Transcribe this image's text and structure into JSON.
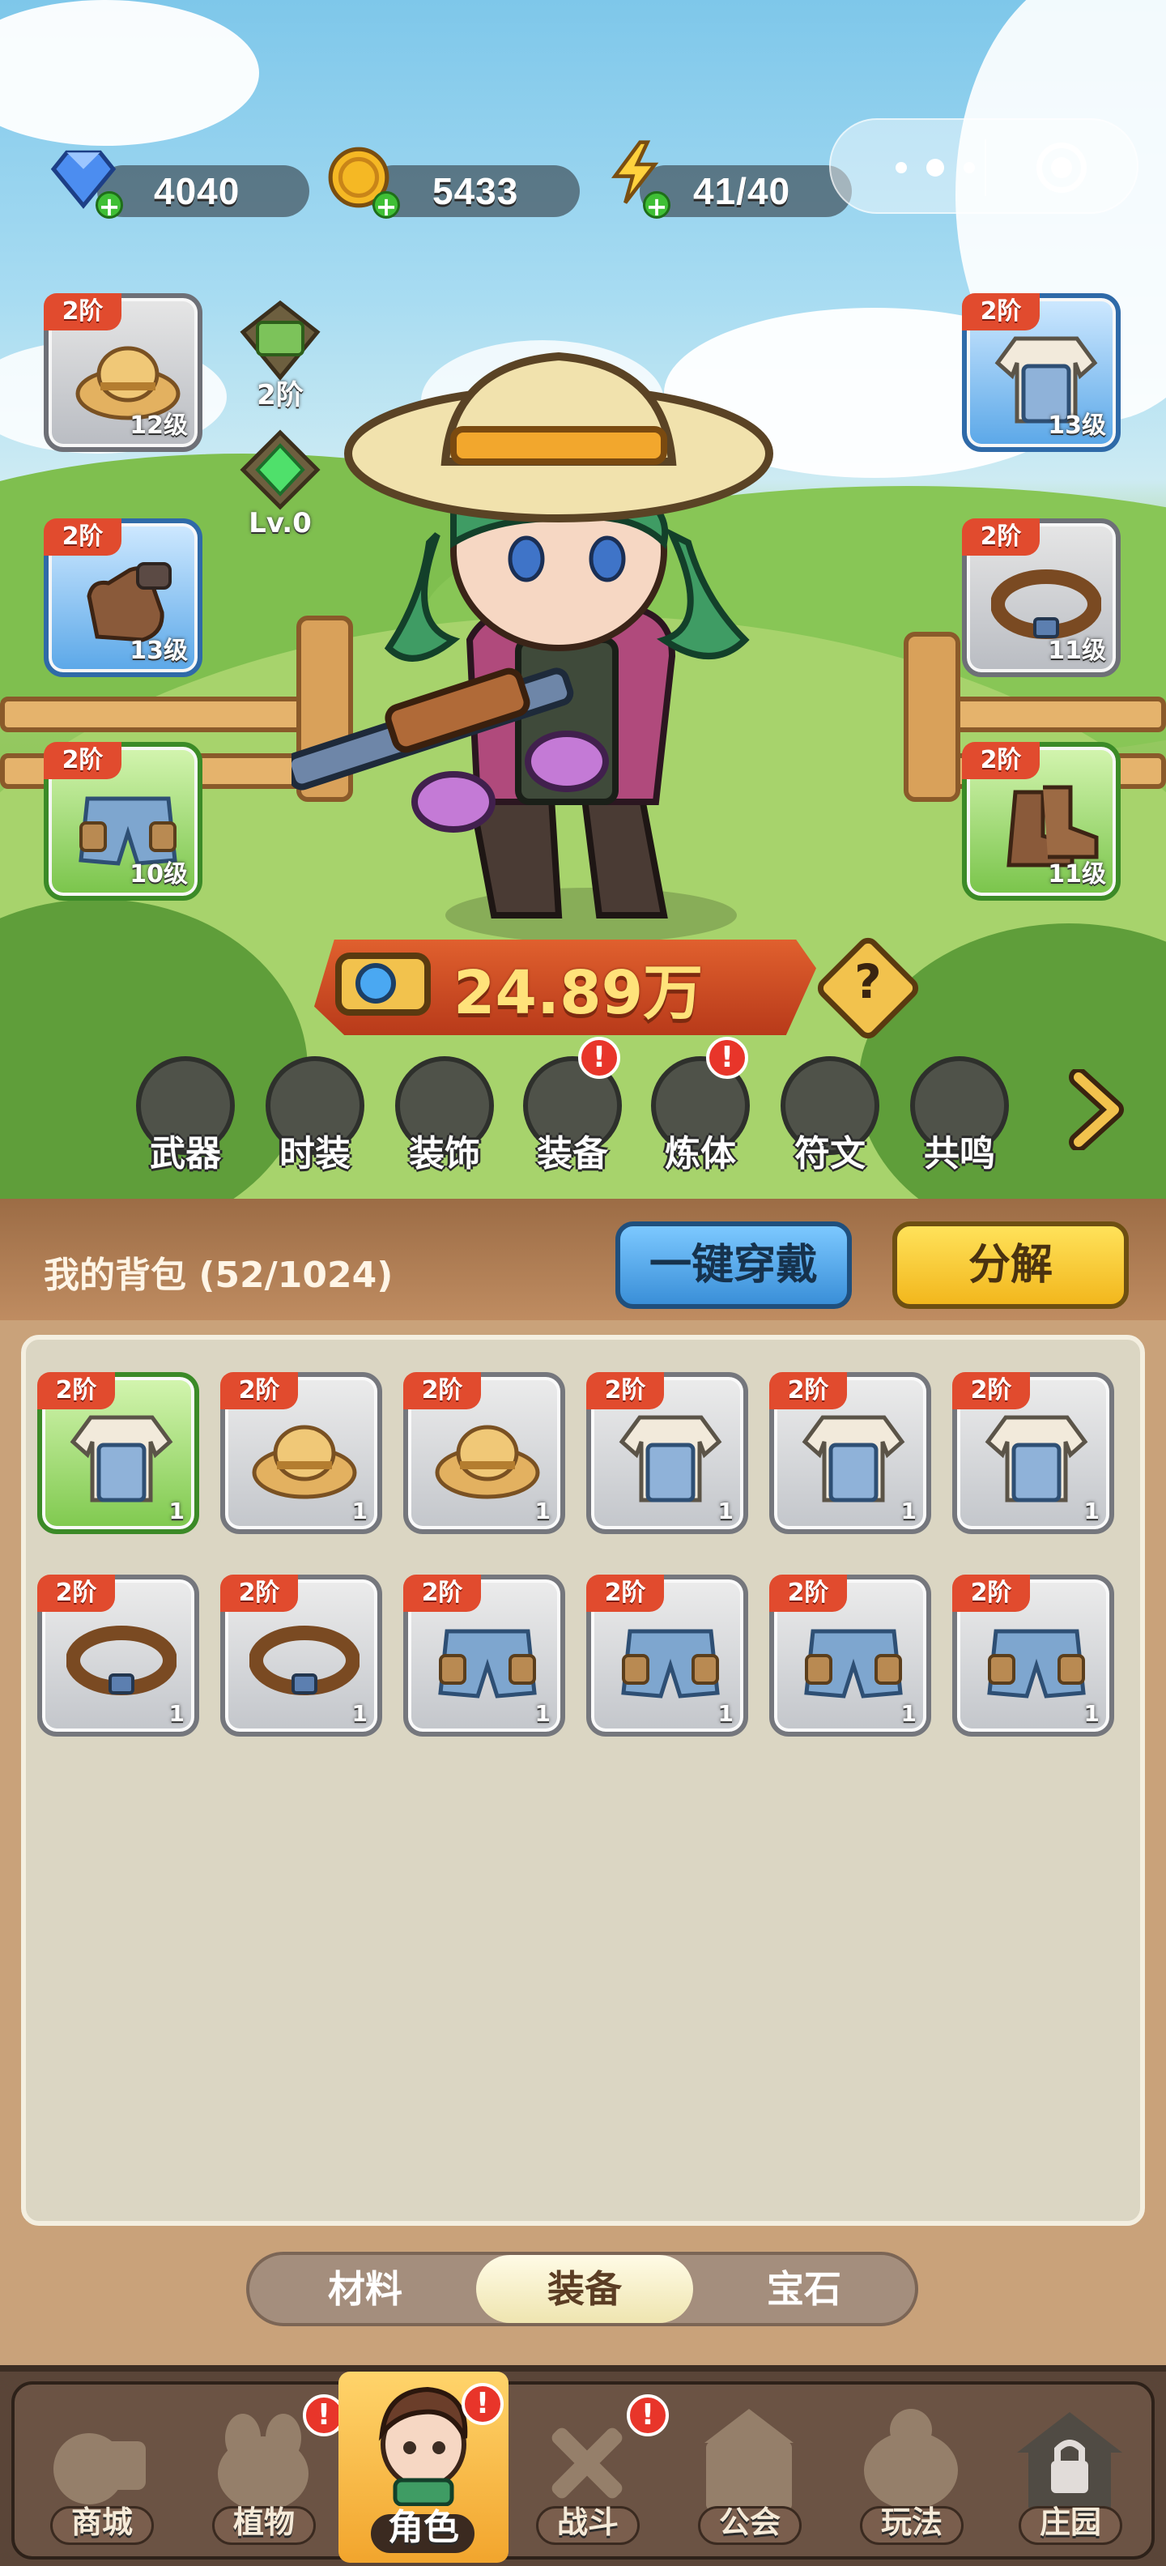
{
  "currencies": {
    "diamonds": "4040",
    "coins": "5433",
    "energy": "41/40"
  },
  "equipment": {
    "left": [
      {
        "tier": "2阶",
        "level": "12级",
        "icon": "straw-hat-icon"
      },
      {
        "tier": "2阶",
        "level": "13级",
        "icon": "glove-icon"
      },
      {
        "tier": "2阶",
        "level": "10级",
        "icon": "shorts-icon"
      }
    ],
    "right": [
      {
        "tier": "2阶",
        "level": "13级",
        "icon": "overalls-shirt-icon"
      },
      {
        "tier": "2阶",
        "level": "11级",
        "icon": "belt-icon"
      },
      {
        "tier": "2阶",
        "level": "11级",
        "icon": "boots-icon"
      }
    ],
    "extras": [
      {
        "label": "2阶",
        "icon": "cash-stack-icon"
      },
      {
        "label": "Lv.0",
        "icon": "green-gem-icon"
      }
    ]
  },
  "power": {
    "value": "24.89万",
    "help_label": "?"
  },
  "functions": [
    {
      "label": "武器",
      "icon": "weapon-icon",
      "alert": false
    },
    {
      "label": "时装",
      "icon": "outfit-icon",
      "alert": false
    },
    {
      "label": "装饰",
      "icon": "mask-icon",
      "alert": false
    },
    {
      "label": "装备",
      "icon": "shovel-icon",
      "alert": true
    },
    {
      "label": "炼体",
      "icon": "body-icon",
      "alert": true
    },
    {
      "label": "符文",
      "icon": "rune-icon",
      "alert": false
    },
    {
      "label": "共鸣",
      "icon": "resonance-icon",
      "alert": false
    }
  ],
  "alert_mark": "!",
  "bag": {
    "title": "我的背包 (52/1024)",
    "wear_all_label": "一键穿戴",
    "decompose_label": "分解",
    "items": [
      {
        "tier": "2阶",
        "qty": "1",
        "icon": "overalls-shirt-icon"
      },
      {
        "tier": "2阶",
        "qty": "1",
        "icon": "straw-hat-icon"
      },
      {
        "tier": "2阶",
        "qty": "1",
        "icon": "straw-hat-icon"
      },
      {
        "tier": "2阶",
        "qty": "1",
        "icon": "overalls-shirt-icon"
      },
      {
        "tier": "2阶",
        "qty": "1",
        "icon": "overalls-shirt-icon"
      },
      {
        "tier": "2阶",
        "qty": "1",
        "icon": "overalls-shirt-icon"
      },
      {
        "tier": "2阶",
        "qty": "1",
        "icon": "belt-icon"
      },
      {
        "tier": "2阶",
        "qty": "1",
        "icon": "belt-icon"
      },
      {
        "tier": "2阶",
        "qty": "1",
        "icon": "shorts-icon"
      },
      {
        "tier": "2阶",
        "qty": "1",
        "icon": "shorts-icon"
      },
      {
        "tier": "2阶",
        "qty": "1",
        "icon": "shorts-icon"
      },
      {
        "tier": "2阶",
        "qty": "1",
        "icon": "shorts-icon"
      }
    ]
  },
  "tabs": [
    {
      "label": "材料",
      "active": false
    },
    {
      "label": "装备",
      "active": true
    },
    {
      "label": "宝石",
      "active": false
    }
  ],
  "nav": [
    {
      "label": "商城",
      "icon": "shop-icon",
      "alert": false,
      "active": false
    },
    {
      "label": "植物",
      "icon": "plant-icon",
      "alert": true,
      "active": false
    },
    {
      "label": "角色",
      "icon": "character-icon",
      "alert": true,
      "active": true
    },
    {
      "label": "战斗",
      "icon": "battle-icon",
      "alert": true,
      "active": false
    },
    {
      "label": "公会",
      "icon": "guild-icon",
      "alert": false,
      "active": false
    },
    {
      "label": "玩法",
      "icon": "gameplay-icon",
      "alert": false,
      "active": false
    },
    {
      "label": "庄园",
      "icon": "manor-lock-icon",
      "alert": false,
      "active": false
    }
  ],
  "colors": {
    "tier_red": "#e14b2e",
    "blue_button": "#3a8fd8",
    "yellow_button": "#f2b71d",
    "power_text": "#ffe27a",
    "alert_red": "#e8352a"
  }
}
